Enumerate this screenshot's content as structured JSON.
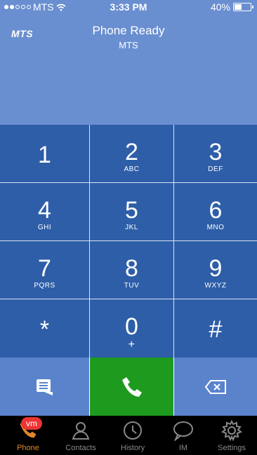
{
  "status_bar": {
    "carrier": "MTS",
    "time": "3:33 PM",
    "battery": "40%"
  },
  "header": {
    "logo": "MTS",
    "title": "Phone Ready",
    "subtitle": "MTS"
  },
  "keypad": [
    {
      "digit": "1",
      "letters": ""
    },
    {
      "digit": "2",
      "letters": "ABC"
    },
    {
      "digit": "3",
      "letters": "DEF"
    },
    {
      "digit": "4",
      "letters": "GHI"
    },
    {
      "digit": "5",
      "letters": "JKL"
    },
    {
      "digit": "6",
      "letters": "MNO"
    },
    {
      "digit": "7",
      "letters": "PQRS"
    },
    {
      "digit": "8",
      "letters": "TUV"
    },
    {
      "digit": "9",
      "letters": "WXYZ"
    },
    {
      "digit": "*",
      "letters": ""
    },
    {
      "digit": "0",
      "letters": "+"
    },
    {
      "digit": "#",
      "letters": ""
    }
  ],
  "actions": {
    "left_icon": "list-icon",
    "call_icon": "phone-icon",
    "right_icon": "backspace-icon",
    "left_color": "#5a83cc",
    "call_color": "#1e9a1e",
    "right_color": "#5a83cc"
  },
  "tabs": [
    {
      "label": "Phone",
      "icon": "phone-icon",
      "badge": "vm",
      "active": true
    },
    {
      "label": "Contacts",
      "icon": "contacts-icon"
    },
    {
      "label": "History",
      "icon": "clock-icon"
    },
    {
      "label": "IM",
      "icon": "chat-bubble-icon"
    },
    {
      "label": "Settings",
      "icon": "gear-icon"
    }
  ],
  "colors": {
    "header_bg": "#6a8fd0",
    "key_bg": "#2e5ea8",
    "accent": "#e2862a",
    "badge": "#e33333"
  }
}
